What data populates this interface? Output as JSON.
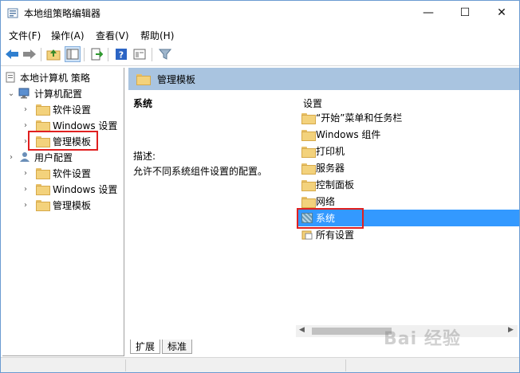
{
  "window": {
    "title": "本地组策略编辑器",
    "minimize": "—",
    "maximize": "☐",
    "close": "✕"
  },
  "menu": [
    "文件(F)",
    "操作(A)",
    "查看(V)",
    "帮助(H)"
  ],
  "tree": {
    "root": "本地计算机 策略",
    "computer": "计算机配置",
    "computer_children": [
      "软件设置",
      "Windows 设置",
      "管理模板"
    ],
    "user": "用户配置",
    "user_children": [
      "软件设置",
      "Windows 设置",
      "管理模板"
    ]
  },
  "right": {
    "header": "管理模板",
    "desc_title": "系统",
    "desc_label": "描述:",
    "desc_text": "允许不同系统组件设置的配置。",
    "column": "设置",
    "items": [
      "“开始”菜单和任务栏",
      "Windows 组件",
      "打印机",
      "服务器",
      "控制面板",
      "网络",
      "系统",
      "所有设置"
    ],
    "selected_index": 6
  },
  "tabs": [
    "扩展",
    "标准"
  ],
  "watermark": "Bai 经验",
  "colors": {
    "selection": "#3399ff",
    "header": "#a9c4e0",
    "highlight_box": "#e02020"
  }
}
